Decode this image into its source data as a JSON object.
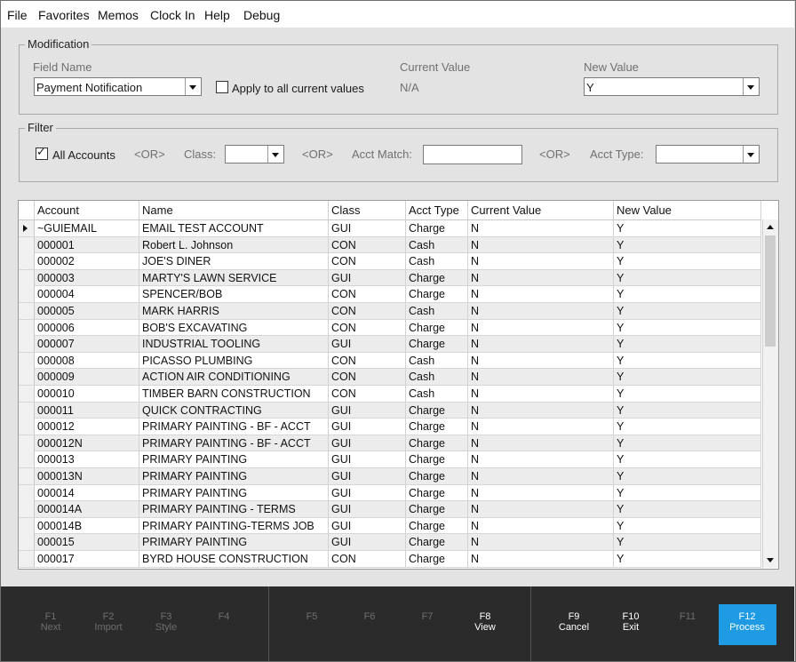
{
  "menu": [
    "File",
    "Favorites",
    "Memos",
    "Clock In",
    "Help",
    "Debug"
  ],
  "modification": {
    "legend": "Modification",
    "field_name_label": "Field Name",
    "field_name_value": "Payment Notification",
    "apply_all_label": "Apply to all current values",
    "current_value_label": "Current Value",
    "current_value": "N/A",
    "new_value_label": "New Value",
    "new_value": "Y"
  },
  "filter": {
    "legend": "Filter",
    "all_accounts_label": "All Accounts",
    "all_accounts_checked": true,
    "or_label": "<OR>",
    "class_label": "Class:",
    "acct_match_label": "Acct Match:",
    "acct_type_label": "Acct Type:"
  },
  "grid": {
    "columns": [
      "Account",
      "Name",
      "Class",
      "Acct Type",
      "Current Value",
      "New Value"
    ],
    "rows": [
      [
        "~GUIEMAIL",
        "EMAIL TEST ACCOUNT",
        "GUI",
        "Charge",
        "N",
        "Y"
      ],
      [
        "000001",
        "Robert L. Johnson",
        "CON",
        "Cash",
        "N",
        "Y"
      ],
      [
        "000002",
        "JOE'S DINER",
        "CON",
        "Cash",
        "N",
        "Y"
      ],
      [
        "000003",
        "MARTY'S LAWN SERVICE",
        "GUI",
        "Charge",
        "N",
        "Y"
      ],
      [
        "000004",
        "SPENCER/BOB",
        "CON",
        "Charge",
        "N",
        "Y"
      ],
      [
        "000005",
        "MARK HARRIS",
        "CON",
        "Cash",
        "N",
        "Y"
      ],
      [
        "000006",
        "BOB'S EXCAVATING",
        "CON",
        "Charge",
        "N",
        "Y"
      ],
      [
        "000007",
        "INDUSTRIAL TOOLING",
        "GUI",
        "Charge",
        "N",
        "Y"
      ],
      [
        "000008",
        "PICASSO PLUMBING",
        "CON",
        "Cash",
        "N",
        "Y"
      ],
      [
        "000009",
        "ACTION AIR CONDITIONING",
        "CON",
        "Cash",
        "N",
        "Y"
      ],
      [
        "000010",
        "TIMBER BARN CONSTRUCTION",
        "CON",
        "Cash",
        "N",
        "Y"
      ],
      [
        "000011",
        "QUICK CONTRACTING",
        "GUI",
        "Charge",
        "N",
        "Y"
      ],
      [
        "000012",
        "PRIMARY PAINTING - BF - ACCT",
        "GUI",
        "Charge",
        "N",
        "Y"
      ],
      [
        "000012N",
        "PRIMARY PAINTING - BF - ACCT",
        "GUI",
        "Charge",
        "N",
        "Y"
      ],
      [
        "000013",
        "PRIMARY PAINTING",
        "GUI",
        "Charge",
        "N",
        "Y"
      ],
      [
        "000013N",
        "PRIMARY PAINTING",
        "GUI",
        "Charge",
        "N",
        "Y"
      ],
      [
        "000014",
        "PRIMARY PAINTING",
        "GUI",
        "Charge",
        "N",
        "Y"
      ],
      [
        "000014A",
        "PRIMARY PAINTING - TERMS",
        "GUI",
        "Charge",
        "N",
        "Y"
      ],
      [
        "000014B",
        "PRIMARY PAINTING-TERMS JOB",
        "GUI",
        "Charge",
        "N",
        "Y"
      ],
      [
        "000015",
        "PRIMARY PAINTING",
        "GUI",
        "Charge",
        "N",
        "Y"
      ],
      [
        "000017",
        "BYRD HOUSE CONSTRUCTION",
        "CON",
        "Charge",
        "N",
        "Y"
      ]
    ]
  },
  "fkeys": [
    {
      "key": "F1",
      "label": "Next",
      "enabled": false
    },
    {
      "key": "F2",
      "label": "Import",
      "enabled": false
    },
    {
      "key": "F3",
      "label": "Style",
      "enabled": false
    },
    {
      "key": "F4",
      "label": "",
      "enabled": false
    },
    {
      "key": "F5",
      "label": "",
      "enabled": false
    },
    {
      "key": "F6",
      "label": "",
      "enabled": false
    },
    {
      "key": "F7",
      "label": "",
      "enabled": false
    },
    {
      "key": "F8",
      "label": "View",
      "enabled": true
    },
    {
      "key": "F9",
      "label": "Cancel",
      "enabled": true
    },
    {
      "key": "F10",
      "label": "Exit",
      "enabled": true
    },
    {
      "key": "F11",
      "label": "",
      "enabled": false
    },
    {
      "key": "F12",
      "label": "Process",
      "enabled": true
    }
  ],
  "colors": {
    "accent": "#1e9be3",
    "fbar_bg": "#2b2b2b"
  }
}
